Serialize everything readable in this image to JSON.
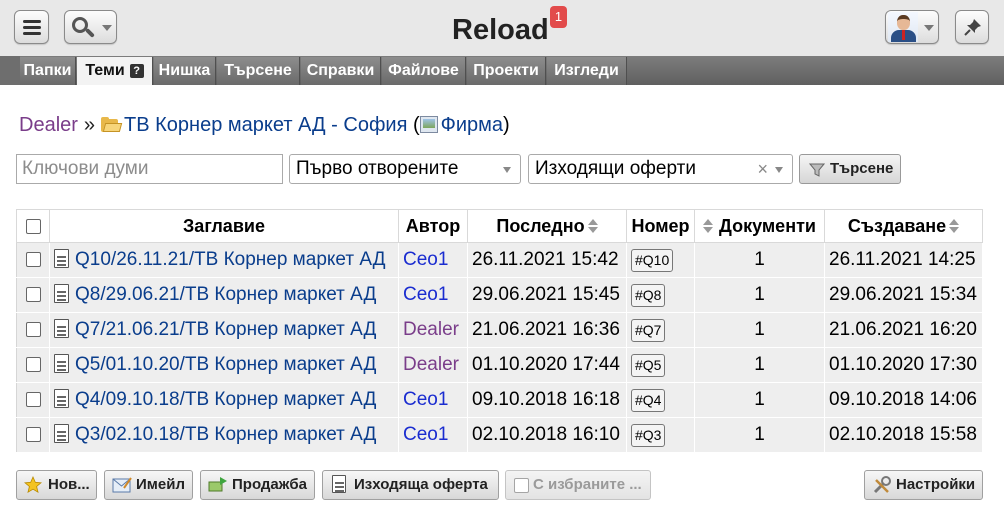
{
  "app": {
    "title": "Reload",
    "notification_count": "1"
  },
  "toolbar": {
    "menu_icon": "hamburger-icon",
    "search_icon": "magnifier-icon",
    "avatar_icon": "user-avatar",
    "pin_icon": "pushpin-icon"
  },
  "nav": {
    "tabs": [
      {
        "label": "Папки",
        "active": false
      },
      {
        "label": "Теми",
        "active": true,
        "help": "?"
      },
      {
        "label": "Нишка",
        "active": false
      },
      {
        "label": "Търсене",
        "active": false
      },
      {
        "label": "Справки",
        "active": false
      },
      {
        "label": "Файлове",
        "active": false
      },
      {
        "label": "Проекти",
        "active": false
      },
      {
        "label": "Изгледи",
        "active": false
      }
    ]
  },
  "breadcrumb": {
    "root": "Dealer",
    "separator": "»",
    "folder": "ТВ Корнер маркет АД - София",
    "open_paren": "(",
    "firm": "Фирма",
    "close_paren": ")"
  },
  "filters": {
    "keywords_placeholder": "Ключови думи",
    "order": "Първо отворените",
    "type": "Изходящи оферти",
    "clear": "×",
    "search_label": "Търсене"
  },
  "table": {
    "headers": {
      "title": "Заглавие",
      "author": "Автор",
      "last": "Последно",
      "number": "Номер",
      "documents": "Документи",
      "created": "Създаване"
    },
    "rows": [
      {
        "title": "Q10/26.11.21/ТВ Корнер маркет АД",
        "author": "Ceo1",
        "author_role": "ceo",
        "last": "26.11.2021 15:42",
        "number": "#Q10",
        "documents": "1",
        "created": "26.11.2021 14:25"
      },
      {
        "title": "Q8/29.06.21/ТВ Корнер маркет АД",
        "author": "Ceo1",
        "author_role": "ceo",
        "last": "29.06.2021 15:45",
        "number": "#Q8",
        "documents": "1",
        "created": "29.06.2021 15:34"
      },
      {
        "title": "Q7/21.06.21/ТВ Корнер маркет АД",
        "author": "Dealer",
        "author_role": "dealer",
        "last": "21.06.2021 16:36",
        "number": "#Q7",
        "documents": "1",
        "created": "21.06.2021 16:20"
      },
      {
        "title": "Q5/01.10.20/ТВ Корнер маркет АД",
        "author": "Dealer",
        "author_role": "dealer",
        "last": "01.10.2020 17:44",
        "number": "#Q5",
        "documents": "1",
        "created": "01.10.2020 17:30"
      },
      {
        "title": "Q4/09.10.18/ТВ Корнер маркет АД",
        "author": "Ceo1",
        "author_role": "ceo",
        "last": "09.10.2018 16:18",
        "number": "#Q4",
        "documents": "1",
        "created": "09.10.2018 14:06"
      },
      {
        "title": "Q3/02.10.18/ТВ Корнер маркет АД",
        "author": "Ceo1",
        "author_role": "ceo",
        "last": "02.10.2018 16:10",
        "number": "#Q3",
        "documents": "1",
        "created": "02.10.2018 15:58"
      }
    ]
  },
  "actions": {
    "new": "Нов...",
    "email": "Имейл",
    "sale": "Продажба",
    "outgoing_offer": "Изходяща оферта",
    "with_selected": "С избраните ...",
    "settings": "Настройки"
  },
  "colors": {
    "link_blue": "#0a3d8c",
    "dealer_purple": "#7a3d8a",
    "ceo_blue": "#1a2cd0",
    "nav_gray": "#6a6a6a",
    "badge_red": "#e24b4b"
  }
}
